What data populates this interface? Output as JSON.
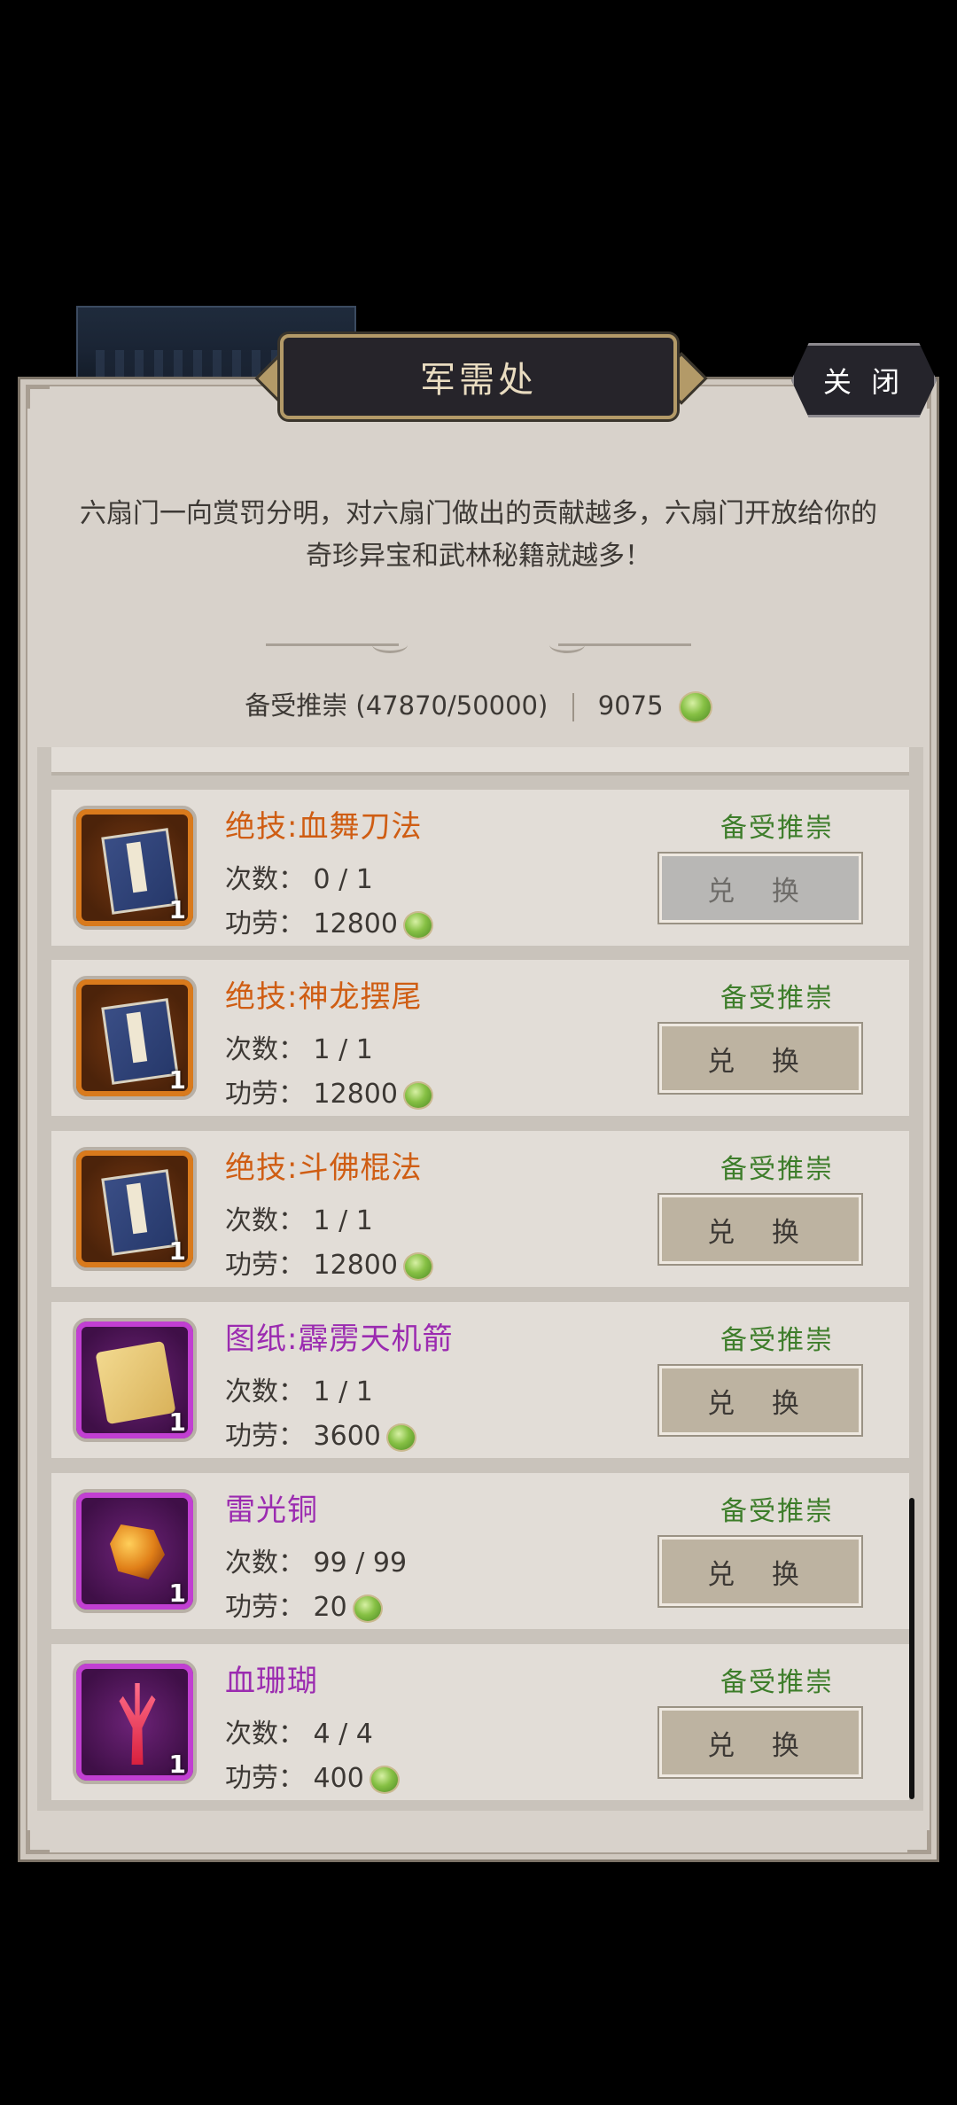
{
  "window": {
    "title": "军需处",
    "close_label": "关 闭"
  },
  "description": "六扇门一向赏罚分明，对六扇门做出的贡献越多，六扇门开放给你的奇珍异宝和武林秘籍就越多！",
  "status": {
    "rank_progress": "备受推崇 (47870/50000)",
    "merit_total": "9075",
    "merit_icon": "jade-coin-icon"
  },
  "colors": {
    "orange_quality": "#d97a1c",
    "purple_quality": "#c13fd2",
    "rank_text": "#3d7d2a"
  },
  "items": [
    {
      "name": "绝技:血舞刀法",
      "icon": "martial-manual-book-icon",
      "quality": "orange",
      "icon_count": "1",
      "count": "次数：  0 / 1",
      "merit": "功劳：  12800",
      "rank": "备受推崇",
      "button": "兑 换",
      "enabled": false
    },
    {
      "name": "绝技:神龙摆尾",
      "icon": "martial-manual-book-icon",
      "quality": "orange",
      "icon_count": "1",
      "count": "次数：  1 / 1",
      "merit": "功劳：  12800",
      "rank": "备受推崇",
      "button": "兑 换",
      "enabled": true
    },
    {
      "name": "绝技:斗佛棍法",
      "icon": "martial-manual-book-icon",
      "quality": "orange",
      "icon_count": "1",
      "count": "次数：  1 / 1",
      "merit": "功劳：  12800",
      "rank": "备受推崇",
      "button": "兑 换",
      "enabled": true
    },
    {
      "name": "图纸:霹雳天机箭",
      "icon": "blueprint-scroll-icon",
      "quality": "purple",
      "icon_count": "1",
      "count": "次数：  1 / 1",
      "merit": "功劳：  3600",
      "rank": "备受推崇",
      "button": "兑 换",
      "enabled": true
    },
    {
      "name": "雷光铜",
      "icon": "thunder-copper-ore-icon",
      "quality": "purple",
      "icon_count": "1",
      "count": "次数：  99 / 99",
      "merit": "功劳：  20",
      "rank": "备受推崇",
      "button": "兑 换",
      "enabled": true
    },
    {
      "name": "血珊瑚",
      "icon": "blood-coral-icon",
      "quality": "purple",
      "icon_count": "1",
      "count": "次数：  4 / 4",
      "merit": "功劳：  400",
      "rank": "备受推崇",
      "button": "兑 换",
      "enabled": true
    }
  ]
}
